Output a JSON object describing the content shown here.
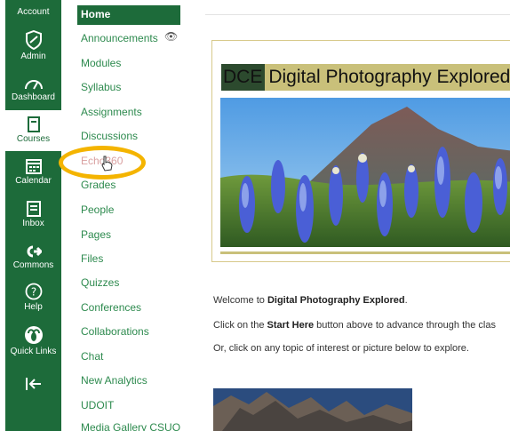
{
  "global_nav": {
    "account": "Account",
    "admin": "Admin",
    "dashboard": "Dashboard",
    "courses": "Courses",
    "calendar": "Calendar",
    "inbox": "Inbox",
    "commons": "Commons",
    "help": "Help",
    "quick_links": "Quick Links"
  },
  "course_nav": {
    "home": "Home",
    "items": [
      "Announcements",
      "Modules",
      "Syllabus",
      "Assignments",
      "Discussions",
      "Echo360",
      "Grades",
      "People",
      "Pages",
      "Files",
      "Quizzes",
      "Conferences",
      "Collaborations",
      "Chat",
      "New Analytics",
      "UDOIT",
      "Media Gallery CSUO"
    ]
  },
  "banner": {
    "dce": "DCE",
    "title": "Digital Photography Explored"
  },
  "content": {
    "welcome_prefix": "Welcome to ",
    "welcome_bold": "Digital Photography Explored",
    "welcome_suffix": ".",
    "line2_prefix": "Click on the ",
    "line2_bold": "Start Here",
    "line2_suffix": " button above to advance through the clas",
    "line3": "Or, click on any topic of interest or picture below to explore."
  },
  "colors": {
    "nav_green": "#1d6b3a",
    "link_green": "#2d8a4e",
    "highlight": "#f4b400",
    "banner_gold": "#c9c07a"
  }
}
